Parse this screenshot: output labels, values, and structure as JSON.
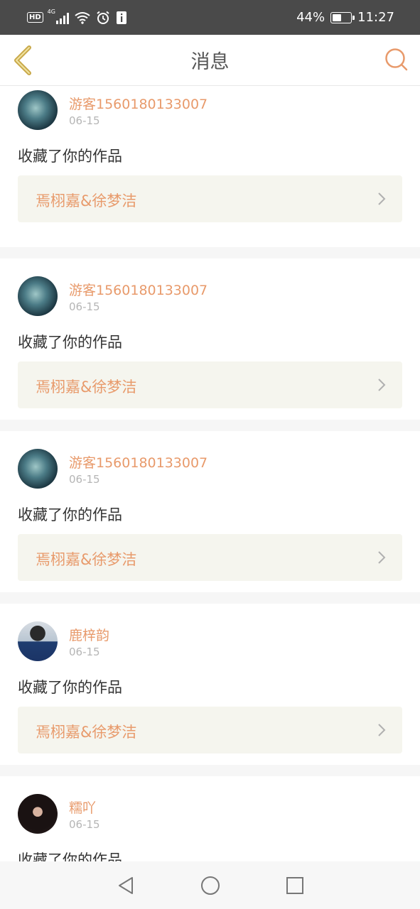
{
  "status_bar": {
    "network_badge": "HD",
    "network_type": "4G",
    "battery_percent": "44%",
    "time": "11:27",
    "icons": [
      "hd-icon",
      "signal-icon",
      "wifi-icon",
      "alarm-icon",
      "notification-icon",
      "battery-icon"
    ]
  },
  "header": {
    "title": "消息",
    "back_icon": "chevron-left-icon",
    "search_icon": "search-icon"
  },
  "messages": [
    {
      "username": "游客1560180133007",
      "date": "06-15",
      "action": "收藏了你的作品",
      "work_title": "焉栩嘉&徐梦洁",
      "avatar": "ghost-avatar"
    },
    {
      "username": "游客1560180133007",
      "date": "06-15",
      "action": "收藏了你的作品",
      "work_title": "焉栩嘉&徐梦洁",
      "avatar": "ghost-avatar"
    },
    {
      "username": "游客1560180133007",
      "date": "06-15",
      "action": "收藏了你的作品",
      "work_title": "焉栩嘉&徐梦洁",
      "avatar": "ghost-avatar"
    },
    {
      "username": "鹿梓韵",
      "date": "06-15",
      "action": "收藏了你的作品",
      "work_title": "焉栩嘉&徐梦洁",
      "avatar": "boy-avatar"
    },
    {
      "username": "糯吖",
      "date": "06-15",
      "action": "收藏了你的作品",
      "work_title": "",
      "avatar": "girl-avatar"
    }
  ],
  "colors": {
    "accent": "#e89a6b",
    "back_icon": "#c9a94a",
    "status_bar": "#4a4a4a",
    "card_link_bg": "#f5f5ee"
  },
  "navbar": {
    "icons": [
      "back-triangle-icon",
      "home-circle-icon",
      "recents-square-icon"
    ]
  }
}
